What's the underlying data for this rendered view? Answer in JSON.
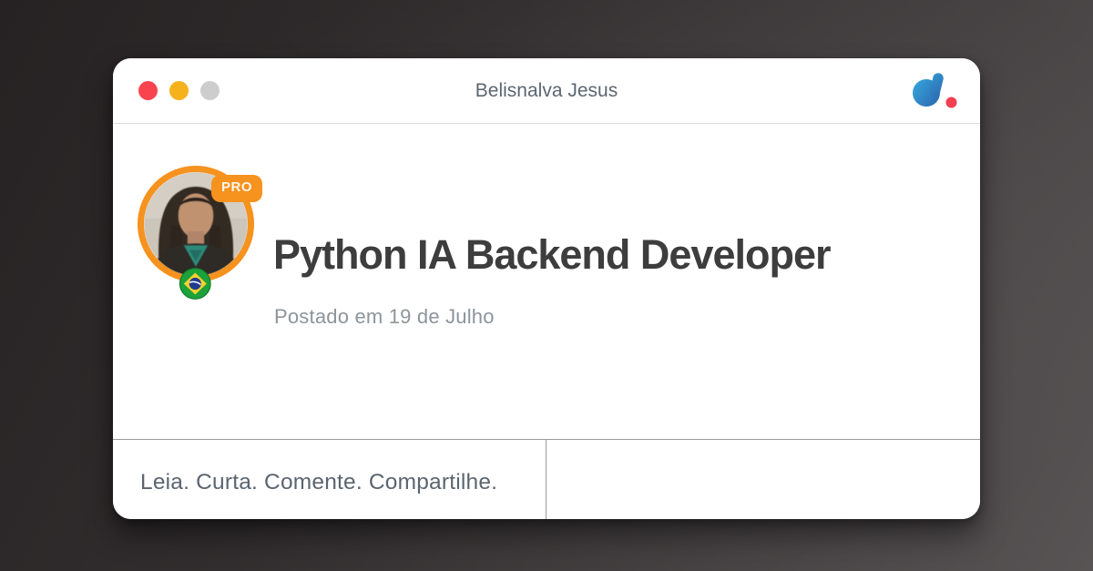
{
  "window": {
    "title": "Belisnalva Jesus",
    "controls": [
      {
        "name": "close-button",
        "color": "#f8444f"
      },
      {
        "name": "minimize-button",
        "color": "#f5b21d"
      },
      {
        "name": "maximize-button",
        "color": "#cdcdcd"
      }
    ]
  },
  "brand": {
    "logo_icon": "dio-logo",
    "logo_gradient_start": "#35a5db",
    "logo_gradient_end": "#2b5fa9",
    "logo_dot_color": "#f33f4f"
  },
  "post": {
    "title": "Python IA Backend Developer",
    "posted": "Postado em 19 de Julho",
    "pro_badge": "PRO",
    "avatar_icon": "user-photo",
    "flag_icon": "brazil-flag",
    "avatar_ring_color": "#f6921e"
  },
  "footer": {
    "cta": "Leia. Curta. Comente. Compartilhe."
  }
}
